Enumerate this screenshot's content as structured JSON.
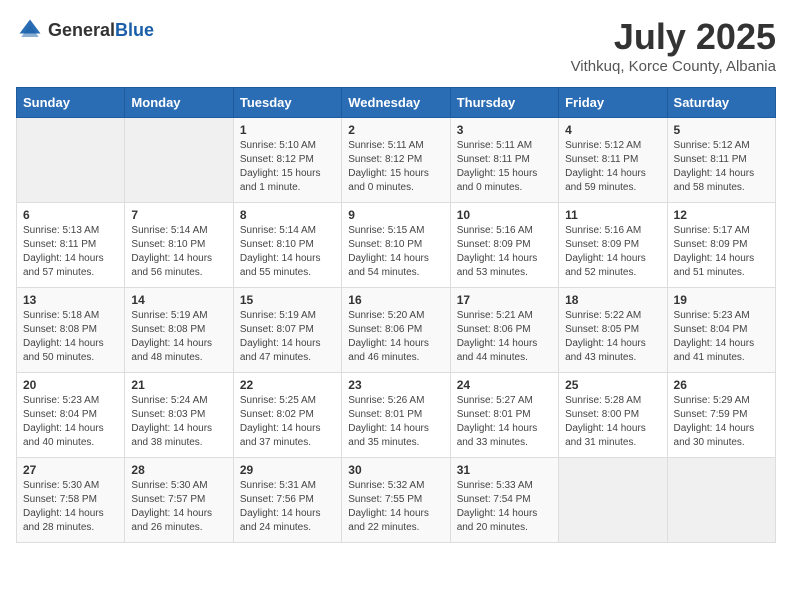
{
  "header": {
    "logo_general": "General",
    "logo_blue": "Blue",
    "title": "July 2025",
    "location": "Vithkuq, Korce County, Albania"
  },
  "days_of_week": [
    "Sunday",
    "Monday",
    "Tuesday",
    "Wednesday",
    "Thursday",
    "Friday",
    "Saturday"
  ],
  "weeks": [
    [
      {
        "day": "",
        "info": ""
      },
      {
        "day": "",
        "info": ""
      },
      {
        "day": "1",
        "info": "Sunrise: 5:10 AM\nSunset: 8:12 PM\nDaylight: 15 hours and 1 minute."
      },
      {
        "day": "2",
        "info": "Sunrise: 5:11 AM\nSunset: 8:12 PM\nDaylight: 15 hours and 0 minutes."
      },
      {
        "day": "3",
        "info": "Sunrise: 5:11 AM\nSunset: 8:11 PM\nDaylight: 15 hours and 0 minutes."
      },
      {
        "day": "4",
        "info": "Sunrise: 5:12 AM\nSunset: 8:11 PM\nDaylight: 14 hours and 59 minutes."
      },
      {
        "day": "5",
        "info": "Sunrise: 5:12 AM\nSunset: 8:11 PM\nDaylight: 14 hours and 58 minutes."
      }
    ],
    [
      {
        "day": "6",
        "info": "Sunrise: 5:13 AM\nSunset: 8:11 PM\nDaylight: 14 hours and 57 minutes."
      },
      {
        "day": "7",
        "info": "Sunrise: 5:14 AM\nSunset: 8:10 PM\nDaylight: 14 hours and 56 minutes."
      },
      {
        "day": "8",
        "info": "Sunrise: 5:14 AM\nSunset: 8:10 PM\nDaylight: 14 hours and 55 minutes."
      },
      {
        "day": "9",
        "info": "Sunrise: 5:15 AM\nSunset: 8:10 PM\nDaylight: 14 hours and 54 minutes."
      },
      {
        "day": "10",
        "info": "Sunrise: 5:16 AM\nSunset: 8:09 PM\nDaylight: 14 hours and 53 minutes."
      },
      {
        "day": "11",
        "info": "Sunrise: 5:16 AM\nSunset: 8:09 PM\nDaylight: 14 hours and 52 minutes."
      },
      {
        "day": "12",
        "info": "Sunrise: 5:17 AM\nSunset: 8:09 PM\nDaylight: 14 hours and 51 minutes."
      }
    ],
    [
      {
        "day": "13",
        "info": "Sunrise: 5:18 AM\nSunset: 8:08 PM\nDaylight: 14 hours and 50 minutes."
      },
      {
        "day": "14",
        "info": "Sunrise: 5:19 AM\nSunset: 8:08 PM\nDaylight: 14 hours and 48 minutes."
      },
      {
        "day": "15",
        "info": "Sunrise: 5:19 AM\nSunset: 8:07 PM\nDaylight: 14 hours and 47 minutes."
      },
      {
        "day": "16",
        "info": "Sunrise: 5:20 AM\nSunset: 8:06 PM\nDaylight: 14 hours and 46 minutes."
      },
      {
        "day": "17",
        "info": "Sunrise: 5:21 AM\nSunset: 8:06 PM\nDaylight: 14 hours and 44 minutes."
      },
      {
        "day": "18",
        "info": "Sunrise: 5:22 AM\nSunset: 8:05 PM\nDaylight: 14 hours and 43 minutes."
      },
      {
        "day": "19",
        "info": "Sunrise: 5:23 AM\nSunset: 8:04 PM\nDaylight: 14 hours and 41 minutes."
      }
    ],
    [
      {
        "day": "20",
        "info": "Sunrise: 5:23 AM\nSunset: 8:04 PM\nDaylight: 14 hours and 40 minutes."
      },
      {
        "day": "21",
        "info": "Sunrise: 5:24 AM\nSunset: 8:03 PM\nDaylight: 14 hours and 38 minutes."
      },
      {
        "day": "22",
        "info": "Sunrise: 5:25 AM\nSunset: 8:02 PM\nDaylight: 14 hours and 37 minutes."
      },
      {
        "day": "23",
        "info": "Sunrise: 5:26 AM\nSunset: 8:01 PM\nDaylight: 14 hours and 35 minutes."
      },
      {
        "day": "24",
        "info": "Sunrise: 5:27 AM\nSunset: 8:01 PM\nDaylight: 14 hours and 33 minutes."
      },
      {
        "day": "25",
        "info": "Sunrise: 5:28 AM\nSunset: 8:00 PM\nDaylight: 14 hours and 31 minutes."
      },
      {
        "day": "26",
        "info": "Sunrise: 5:29 AM\nSunset: 7:59 PM\nDaylight: 14 hours and 30 minutes."
      }
    ],
    [
      {
        "day": "27",
        "info": "Sunrise: 5:30 AM\nSunset: 7:58 PM\nDaylight: 14 hours and 28 minutes."
      },
      {
        "day": "28",
        "info": "Sunrise: 5:30 AM\nSunset: 7:57 PM\nDaylight: 14 hours and 26 minutes."
      },
      {
        "day": "29",
        "info": "Sunrise: 5:31 AM\nSunset: 7:56 PM\nDaylight: 14 hours and 24 minutes."
      },
      {
        "day": "30",
        "info": "Sunrise: 5:32 AM\nSunset: 7:55 PM\nDaylight: 14 hours and 22 minutes."
      },
      {
        "day": "31",
        "info": "Sunrise: 5:33 AM\nSunset: 7:54 PM\nDaylight: 14 hours and 20 minutes."
      },
      {
        "day": "",
        "info": ""
      },
      {
        "day": "",
        "info": ""
      }
    ]
  ]
}
